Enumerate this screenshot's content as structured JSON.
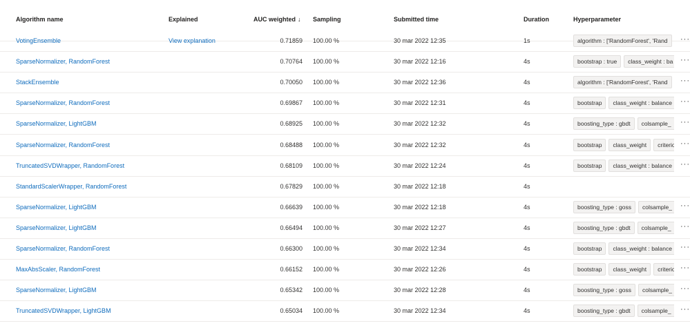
{
  "header": {
    "algorithm": "Algorithm name",
    "explained": "Explained",
    "auc": "AUC weighted",
    "sort_arrow": "↓",
    "sampling": "Sampling",
    "submitted": "Submitted time",
    "duration": "Duration",
    "hyperparameter": "Hyperparameter"
  },
  "rows": [
    {
      "algorithm": "VotingEnsemble",
      "explained": "View explanation",
      "auc": "0.71859",
      "sampling": "100.00 %",
      "submitted": "30 mar 2022 12:35",
      "duration": "1s",
      "tags": [
        "algorithm : ['RandomForest', 'Rand"
      ],
      "more": "···"
    },
    {
      "algorithm": "SparseNormalizer, RandomForest",
      "explained": "",
      "auc": "0.70764",
      "sampling": "100.00 %",
      "submitted": "30 mar 2022 12:16",
      "duration": "4s",
      "tags": [
        "bootstrap : true",
        "class_weight : ba"
      ],
      "more": "···"
    },
    {
      "algorithm": "StackEnsemble",
      "explained": "",
      "auc": "0.70050",
      "sampling": "100.00 %",
      "submitted": "30 mar 2022 12:36",
      "duration": "4s",
      "tags": [
        "algorithm : ['RandomForest', 'Rand"
      ],
      "more": "···"
    },
    {
      "algorithm": "SparseNormalizer, RandomForest",
      "explained": "",
      "auc": "0.69867",
      "sampling": "100.00 %",
      "submitted": "30 mar 2022 12:31",
      "duration": "4s",
      "tags": [
        "bootstrap",
        "class_weight : balance"
      ],
      "more": "···"
    },
    {
      "algorithm": "SparseNormalizer, LightGBM",
      "explained": "",
      "auc": "0.68925",
      "sampling": "100.00 %",
      "submitted": "30 mar 2022 12:32",
      "duration": "4s",
      "tags": [
        "boosting_type : gbdt",
        "colsample_"
      ],
      "more": "···"
    },
    {
      "algorithm": "SparseNormalizer, RandomForest",
      "explained": "",
      "auc": "0.68488",
      "sampling": "100.00 %",
      "submitted": "30 mar 2022 12:32",
      "duration": "4s",
      "tags": [
        "bootstrap",
        "class_weight",
        "criterio"
      ],
      "more": "···"
    },
    {
      "algorithm": "TruncatedSVDWrapper, RandomForest",
      "explained": "",
      "auc": "0.68109",
      "sampling": "100.00 %",
      "submitted": "30 mar 2022 12:24",
      "duration": "4s",
      "tags": [
        "bootstrap",
        "class_weight : balance"
      ],
      "more": "···"
    },
    {
      "algorithm": "StandardScalerWrapper, RandomForest",
      "explained": "",
      "auc": "0.67829",
      "sampling": "100.00 %",
      "submitted": "30 mar 2022 12:18",
      "duration": "4s",
      "tags": [],
      "more": ""
    },
    {
      "algorithm": "SparseNormalizer, LightGBM",
      "explained": "",
      "auc": "0.66639",
      "sampling": "100.00 %",
      "submitted": "30 mar 2022 12:18",
      "duration": "4s",
      "tags": [
        "boosting_type : goss",
        "colsample_"
      ],
      "more": "···"
    },
    {
      "algorithm": "SparseNormalizer, LightGBM",
      "explained": "",
      "auc": "0.66494",
      "sampling": "100.00 %",
      "submitted": "30 mar 2022 12:27",
      "duration": "4s",
      "tags": [
        "boosting_type : gbdt",
        "colsample_"
      ],
      "more": "···"
    },
    {
      "algorithm": "SparseNormalizer, RandomForest",
      "explained": "",
      "auc": "0.66300",
      "sampling": "100.00 %",
      "submitted": "30 mar 2022 12:34",
      "duration": "4s",
      "tags": [
        "bootstrap",
        "class_weight : balance"
      ],
      "more": "···"
    },
    {
      "algorithm": "MaxAbsScaler, RandomForest",
      "explained": "",
      "auc": "0.66152",
      "sampling": "100.00 %",
      "submitted": "30 mar 2022 12:26",
      "duration": "4s",
      "tags": [
        "bootstrap",
        "class_weight",
        "criterio"
      ],
      "more": "···"
    },
    {
      "algorithm": "SparseNormalizer, LightGBM",
      "explained": "",
      "auc": "0.65342",
      "sampling": "100.00 %",
      "submitted": "30 mar 2022 12:28",
      "duration": "4s",
      "tags": [
        "boosting_type : goss",
        "colsample_"
      ],
      "more": "···"
    },
    {
      "algorithm": "TruncatedSVDWrapper, LightGBM",
      "explained": "",
      "auc": "0.65034",
      "sampling": "100.00 %",
      "submitted": "30 mar 2022 12:34",
      "duration": "4s",
      "tags": [
        "boosting_type : gbdt",
        "colsample_"
      ],
      "more": "···"
    }
  ]
}
